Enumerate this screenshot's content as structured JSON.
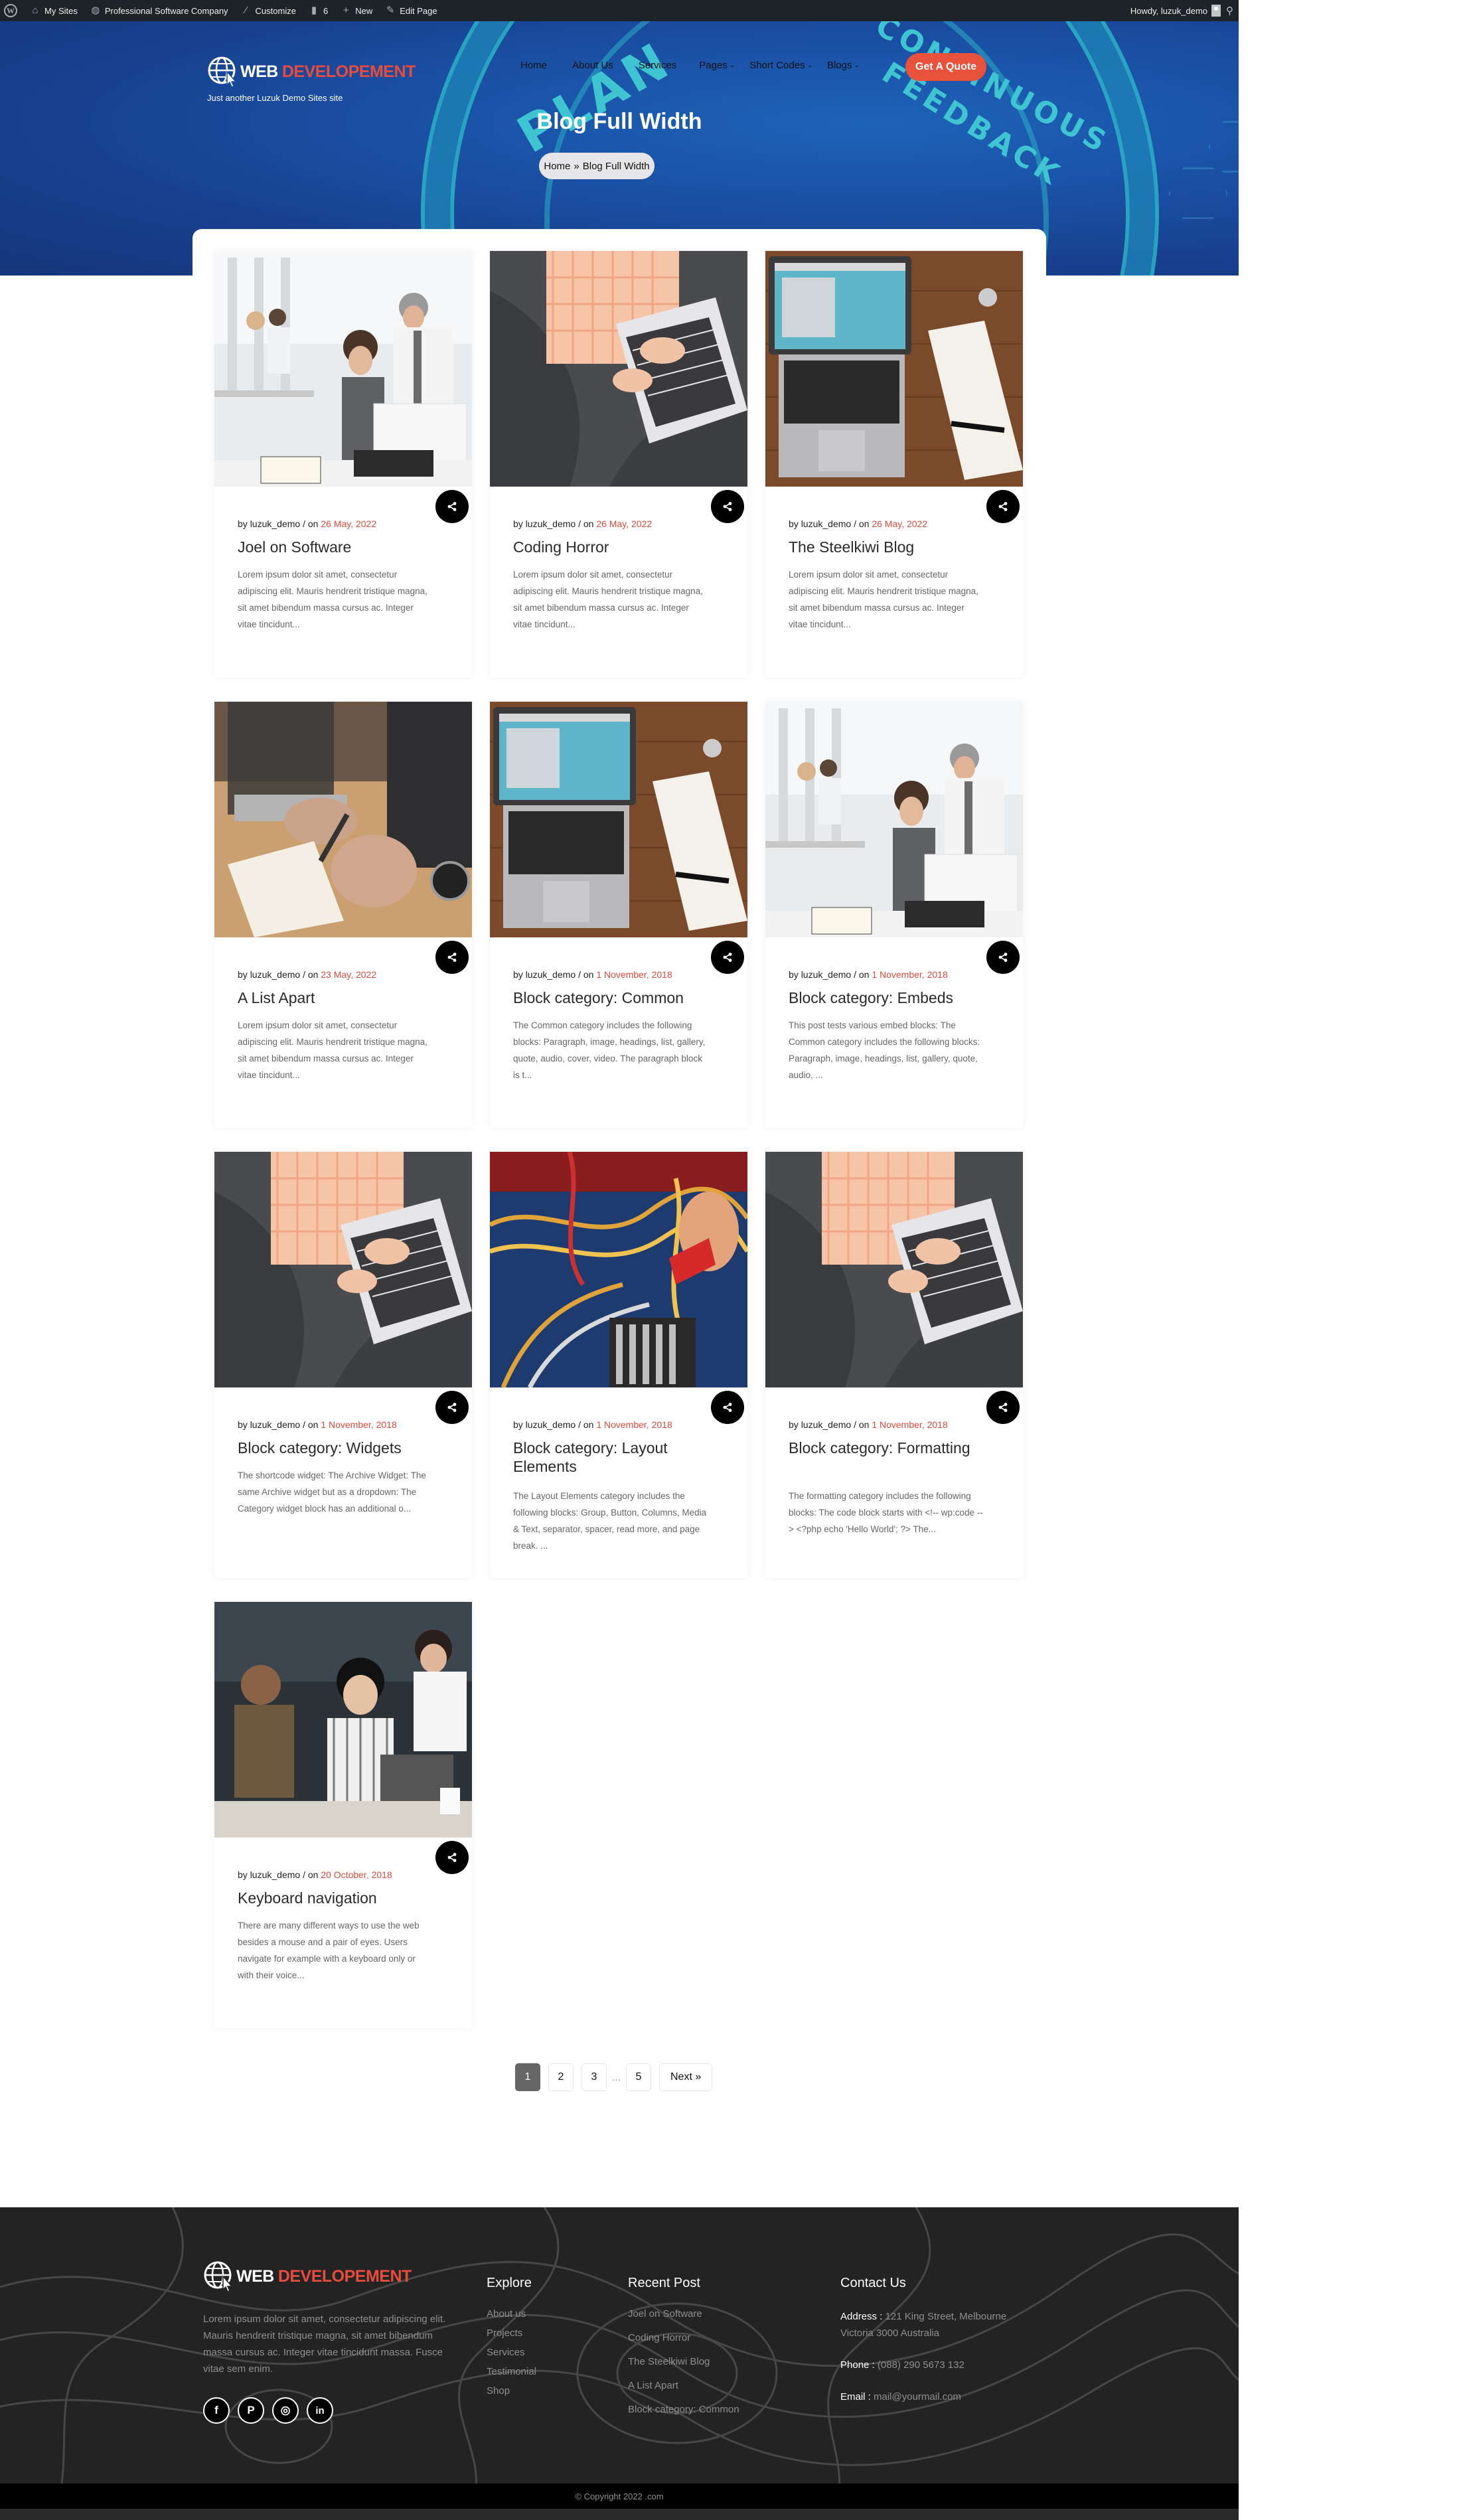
{
  "admin_bar": {
    "items": [
      {
        "icon": "wordpress-icon",
        "label": ""
      },
      {
        "icon": "my-sites-icon",
        "label": "My Sites"
      },
      {
        "icon": "site-dashboard-icon",
        "label": "Professional Software Company"
      },
      {
        "icon": "customize-brush-icon",
        "label": "Customize"
      },
      {
        "icon": "comments-icon",
        "label": "6"
      },
      {
        "icon": "plus-icon",
        "label": "New"
      },
      {
        "icon": "edit-pencil-icon",
        "label": "Edit Page"
      }
    ],
    "greeting": "Howdy, luzuk_demo",
    "search_icon": "search-icon"
  },
  "header": {
    "logo_text_white": "WEB",
    "logo_text_accent": "DEVELOPEMENT",
    "tagline": "Just another Luzuk Demo Sites site",
    "nav": [
      {
        "label": "Home",
        "dropdown": false
      },
      {
        "label": "About Us",
        "dropdown": false
      },
      {
        "label": "Services",
        "dropdown": false
      },
      {
        "label": "Pages",
        "dropdown": true
      },
      {
        "label": "Short Codes",
        "dropdown": true
      },
      {
        "label": "Blogs",
        "dropdown": true
      }
    ],
    "cta_label": "Get A Quote"
  },
  "hero": {
    "title": "Blog Full Width",
    "breadcrumb": {
      "home": "Home",
      "separator": "»",
      "current": "Blog Full Width"
    },
    "background_words": [
      "PLAN",
      "CONTINUOUS",
      "FEEDBACK"
    ]
  },
  "posts": [
    {
      "author": "luzuk_demo",
      "by": "by",
      "on": "/ on",
      "date": "26 May, 2022",
      "title": "Joel on Software",
      "excerpt": "Lorem ipsum dolor sit amet, consectetur adipiscing elit. Mauris hendrerit tristique magna, sit amet bibendum massa cursus ac. Integer vitae tincidunt...",
      "image": "office-team-laptop"
    },
    {
      "author": "luzuk_demo",
      "by": "by",
      "on": "/ on",
      "date": "26 May, 2022",
      "title": "Coding Horror",
      "excerpt": "Lorem ipsum dolor sit amet, consectetur adipiscing elit. Mauris hendrerit tristique magna, sit amet bibendum massa cursus ac. Integer vitae tincidunt...",
      "image": "woman-typing-laptop"
    },
    {
      "author": "luzuk_demo",
      "by": "by",
      "on": "/ on",
      "date": "26 May, 2022",
      "title": "The Steelkiwi Blog",
      "excerpt": "Lorem ipsum dolor sit amet, consectetur adipiscing elit. Mauris hendrerit tristique magna, sit amet bibendum massa cursus ac. Integer vitae tincidunt...",
      "image": "laptop-wooden-desk"
    },
    {
      "author": "luzuk_demo",
      "by": "by",
      "on": "/ on",
      "date": "23 May, 2022",
      "title": "A List Apart",
      "excerpt": "Lorem ipsum dolor sit amet, consectetur adipiscing elit. Mauris hendrerit tristique magna, sit amet bibendum massa cursus ac. Integer vitae tincidunt...",
      "image": "hand-writing-notebook"
    },
    {
      "author": "luzuk_demo",
      "by": "by",
      "on": "/ on",
      "date": "1 November, 2018",
      "title": "Block category: Common",
      "excerpt": "The Common category includes the following blocks: Paragraph, image, headings, list, gallery, quote, audio, cover, video. The paragraph block is t...",
      "image": "laptop-wooden-desk"
    },
    {
      "author": "luzuk_demo",
      "by": "by",
      "on": "/ on",
      "date": "1 November, 2018",
      "title": "Block category: Embeds",
      "excerpt": "This post tests various embed blocks: The Common category includes the following blocks: Paragraph, image, headings, list, gallery, quote, audio, ...",
      "image": "office-team-laptop"
    },
    {
      "author": "luzuk_demo",
      "by": "by",
      "on": "/ on",
      "date": "1 November, 2018",
      "title": "Block category: Widgets",
      "excerpt": "The shortcode widget: The Archive Widget: The same Archive widget but as a dropdown: The Category widget block has an additional o...",
      "image": "woman-typing-laptop"
    },
    {
      "author": "luzuk_demo",
      "by": "by",
      "on": "/ on",
      "date": "1 November, 2018",
      "title": "Block category: Layout Elements",
      "excerpt": "The Layout Elements category includes the following blocks: Group, Button, Columns, Media & Text, separator, spacer, read more, and page break. ...",
      "image": "circuit-board-wires"
    },
    {
      "author": "luzuk_demo",
      "by": "by",
      "on": "/ on",
      "date": "1 November, 2018",
      "title": "Block category: Formatting",
      "excerpt": "The formatting category includes the following blocks: The code block starts with <!-- wp:code --> <?php echo 'Hello World'; ?> The...",
      "image": "woman-typing-laptop"
    },
    {
      "author": "luzuk_demo",
      "by": "by",
      "on": "/ on",
      "date": "20 October, 2018",
      "title": "Keyboard navigation",
      "excerpt": "There are many different ways to use the web besides a mouse and a pair of eyes. Users navigate for example with a keyboard only or with their voice...",
      "image": "team-meeting-laptops"
    }
  ],
  "pagination": {
    "pages": [
      "1",
      "2",
      "3"
    ],
    "dots": "…",
    "last": "5",
    "next": "Next »",
    "current": "1"
  },
  "footer": {
    "logo_text_white": "WEB",
    "logo_text_accent": "DEVELOPEMENT",
    "about": "Lorem ipsum dolor sit amet, consectetur adipiscing elit. Mauris hendrerit tristique magna, sit amet bibendum massa cursus ac. Integer vitae tincidunt massa. Fusce vitae sem enim.",
    "socials": [
      {
        "icon": "facebook-icon",
        "glyph": "f"
      },
      {
        "icon": "pinterest-icon",
        "glyph": "P"
      },
      {
        "icon": "instagram-icon",
        "glyph": "◎"
      },
      {
        "icon": "linkedin-icon",
        "glyph": "in"
      }
    ],
    "explore": {
      "heading": "Explore",
      "links": [
        "About us",
        "Projects",
        "Services",
        "Testimonial",
        "Shop"
      ]
    },
    "recent": {
      "heading": "Recent Post",
      "links": [
        "Joel on Software",
        "Coding Horror",
        "The Steelkiwi Blog",
        "A List Apart",
        "Block category: Common"
      ]
    },
    "contact": {
      "heading": "Contact Us",
      "address_label": "Address :",
      "address": "121 King Street, Melbourne Victoria 3000 Australia",
      "phone_label": "Phone :",
      "phone": "(088) 290 5673 132",
      "email_label": "Email :",
      "email": "mail@yourmail.com"
    },
    "copyright": "© Copyright 2022 .com"
  },
  "colors": {
    "accent": "#e8513b",
    "date": "#dc4b3a",
    "admin_bar": "#1d2327",
    "footer_bg": "#232323"
  }
}
